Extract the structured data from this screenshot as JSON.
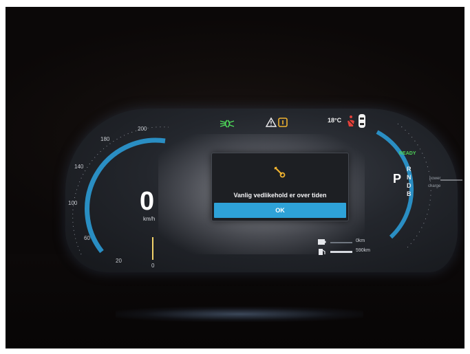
{
  "speedometer": {
    "speed": "0",
    "unit": "km/h",
    "ticks": [
      "200",
      "180",
      "140",
      "100",
      "60",
      "20",
      "0"
    ]
  },
  "top_bar": {
    "outside_temp": "18°C",
    "icons": [
      "low-beam-headlight-icon",
      "warning-triangle-icon",
      "info-icon",
      "seatbelt-warning-icon",
      "car-top-view-icon"
    ],
    "colors": {
      "headlight": "#4fe05a",
      "seatbelt": "#e2403a",
      "info": "#f0b330"
    }
  },
  "dialog": {
    "message": "Vanlig vedlikehold er over tiden",
    "button_label": "OK",
    "icon": "wrench-icon",
    "accent_color": "#2ea2d8"
  },
  "right_gauge": {
    "status": "READY",
    "gear_selected": "P",
    "gears": [
      "R",
      "N",
      "D",
      "B"
    ],
    "power_labels": [
      "power",
      "charge"
    ]
  },
  "range": {
    "electric": "0km",
    "fuel": "590km"
  }
}
